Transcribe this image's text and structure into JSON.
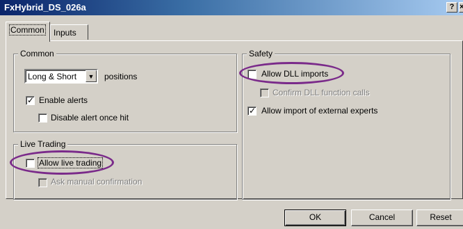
{
  "window": {
    "title": "FxHybrid_DS_026a",
    "help_label": "?",
    "close_label": "×"
  },
  "tabs": [
    {
      "label": "Common",
      "active": true
    },
    {
      "label": "Inputs",
      "active": false
    }
  ],
  "common": {
    "group_label": "Common",
    "positions_select_value": "Long & Short",
    "positions_label": "positions",
    "enable_alerts": {
      "label": "Enable alerts",
      "checked": true,
      "enabled": true
    },
    "disable_alert": {
      "label": "Disable alert once hit",
      "checked": false,
      "enabled": true
    }
  },
  "live_trading": {
    "group_label": "Live Trading",
    "allow_live": {
      "label": "Allow live trading",
      "checked": false,
      "enabled": true
    },
    "ask_manual": {
      "label": "Ask manual confirmation",
      "checked": false,
      "enabled": false
    }
  },
  "safety": {
    "group_label": "Safety",
    "allow_dll": {
      "label": "Allow DLL imports",
      "checked": false,
      "enabled": true
    },
    "confirm_dll": {
      "label": "Confirm DLL function calls",
      "checked": false,
      "enabled": false
    },
    "allow_import": {
      "label": "Allow import of external experts",
      "checked": true,
      "enabled": true
    }
  },
  "buttons": {
    "ok": "OK",
    "cancel": "Cancel",
    "reset": "Reset"
  },
  "annotation_color": "#7a2a8a"
}
